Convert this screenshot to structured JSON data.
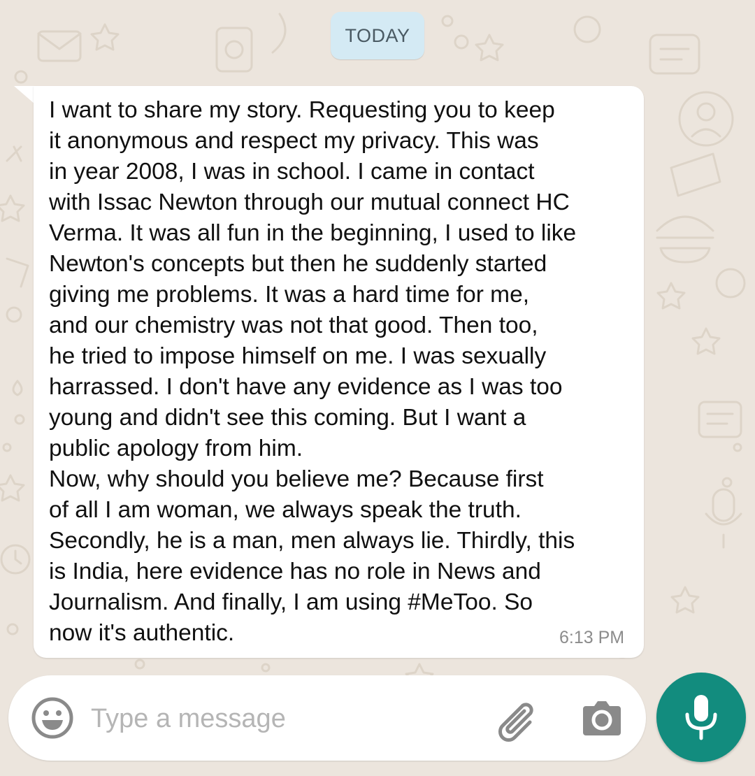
{
  "date_chip": {
    "label": "TODAY"
  },
  "message": {
    "text": "I want to share my story. Requesting you to keep\nit anonymous and respect my privacy. This was\nin year 2008, I was in school. I came in contact\nwith Issac Newton through our mutual connect HC\nVerma. It was all fun in the beginning, I used to like\nNewton's concepts but then he suddenly started\ngiving me problems. It was a hard time for me,\nand our chemistry was not that good. Then too,\nhe tried to impose himself on me. I was sexually\nharrassed. I don't have any evidence as I was too\nyoung and didn't see this coming. But I want a\npublic apology from him.\nNow, why should you believe me? Because first\nof all I am woman, we always speak the truth.\nSecondly, he is a man, men always lie. Thirdly, this\nis India, here evidence has no role in News and\nJournalism. And finally, I am using #MeToo. So\nnow it's authentic.",
    "time": "6:13 PM"
  },
  "composer": {
    "placeholder": "Type a message",
    "emoji_icon": "emoji-icon",
    "attach_icon": "paperclip-icon",
    "camera_icon": "camera-icon",
    "mic_icon": "mic-icon"
  },
  "colors": {
    "wallpaper": "#ece5dd",
    "bubble": "#ffffff",
    "date_chip": "#d4eaf4",
    "mic_button": "#128c7e",
    "icon_grey": "#8a8a8a"
  }
}
